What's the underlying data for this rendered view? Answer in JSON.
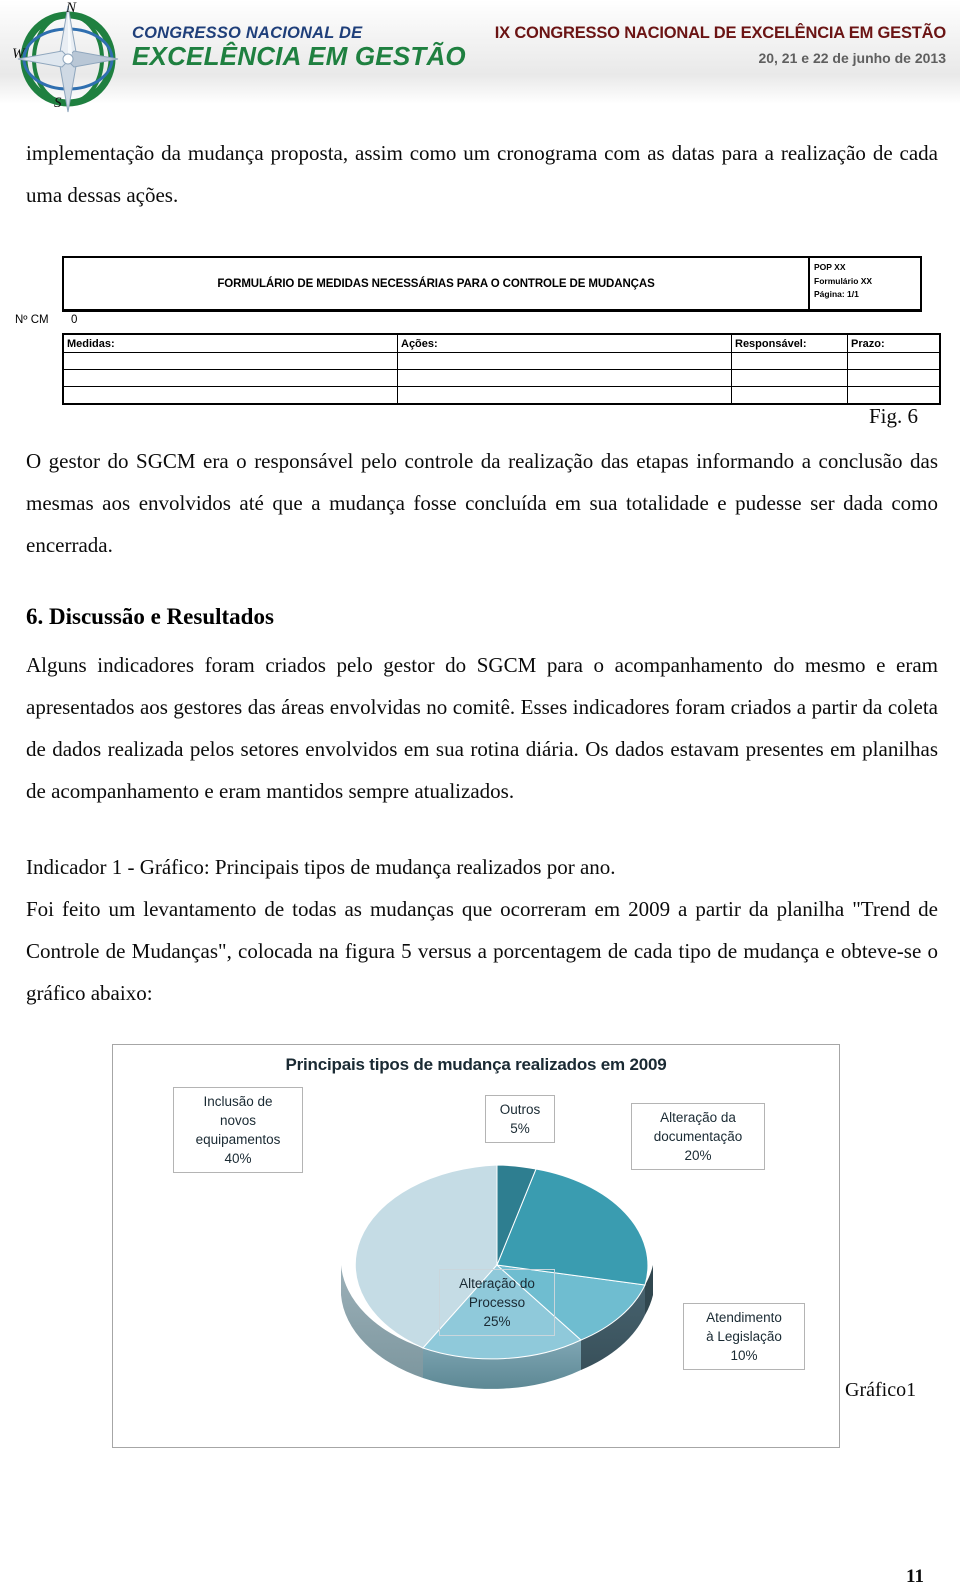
{
  "header": {
    "logo_line1": "CONGRESSO NACIONAL DE",
    "logo_line2": "EXCELÊNCIA EM GESTÃO",
    "compass_n": "N",
    "compass_s": "S",
    "compass_w": "W",
    "title": "IX CONGRESSO NACIONAL DE EXCELÊNCIA EM GESTÃO",
    "date": "20, 21 e  22 de junho de 2013",
    "title_color": "#6b1414",
    "date_color": "#5f5f5f",
    "logo_blue": "#1f3f7a",
    "logo_green": "#1f8040"
  },
  "body": {
    "paragraph_top": "implementação da mudança proposta, assim como um cronograma com as datas para a realização de cada uma dessas ações.",
    "fig_caption": "Fig. 6",
    "paragraph_gestor": "O gestor do SGCM era o responsável pelo controle da realização das etapas informando a conclusão das mesmas aos envolvidos até que a mudança fosse concluída em sua totalidade e pudesse ser dada como encerrada.",
    "section_heading": "6. Discussão e Resultados",
    "paragraph_discussao": "Alguns indicadores foram criados pelo gestor do SGCM para o acompanhamento do mesmo e eram apresentados aos gestores das áreas envolvidas no comitê. Esses indicadores foram criados a partir da coleta de dados realizada pelos setores envolvidos em sua rotina diária. Os dados estavam presentes em planilhas de acompanhamento e eram mantidos sempre atualizados.",
    "paragraph_indicador": "Indicador 1 -  Gráfico: Principais tipos de mudança realizados por ano.",
    "paragraph_foi": "Foi feito um levantamento de todas as mudanças que ocorreram em 2009 a partir da planilha \"Trend de Controle de Mudanças\", colocada na figura 5 versus a porcentagem de cada tipo de mudança e obteve-se o gráfico abaixo:",
    "chart_label": "Gráfico1",
    "page_number": "11"
  },
  "form": {
    "title": "FORMULÁRIO DE MEDIDAS NECESSÁRIAS PARA O CONTROLE DE MUDANÇAS",
    "meta": [
      "POP XX",
      "Formulário XX",
      "Página: 1/1"
    ],
    "ncm_label": "Nº CM",
    "ncm_value": "0",
    "columns": [
      "Medidas:",
      "Ações:",
      "Responsável:",
      "Prazo:"
    ],
    "rows": [
      [
        "",
        "",
        "",
        ""
      ],
      [
        "",
        "",
        "",
        ""
      ],
      [
        "",
        "",
        "",
        ""
      ]
    ]
  },
  "chart_data": {
    "type": "pie",
    "title": "Principais tipos de mudança realizados em 2009",
    "xlabel": "",
    "ylabel": "",
    "legend_position": "none",
    "grid": false,
    "three_d": true,
    "categories": [
      "Inclusão de novos equipamentos",
      "Outros",
      "Alteração da documentação",
      "Atendimento à Legislação",
      "Alteração do Processo"
    ],
    "values": [
      40,
      5,
      20,
      10,
      25
    ],
    "unit": "%",
    "colors": [
      "#c5dce5",
      "#2e7e90",
      "#3a9cb0",
      "#6fbdd0",
      "#8fc9da"
    ],
    "labels": [
      {
        "name": "Inclusão de novos equipamentos",
        "value": 40,
        "text": "Inclusão de\nnovos\nequipamentos\n40%"
      },
      {
        "name": "Outros",
        "value": 5,
        "text": "Outros\n5%"
      },
      {
        "name": "Alteração da documentação",
        "value": 20,
        "text": "Alteração da\ndocumentação\n20%"
      },
      {
        "name": "Alteração do Processo",
        "value": 25,
        "text": "Alteração do\nProcesso\n25%"
      },
      {
        "name": "Atendimento à Legislação",
        "value": 10,
        "text": "Atendimento\nà Legislação\n10%"
      }
    ],
    "callout_equipamentos_l1": "Inclusão de",
    "callout_equipamentos_l2": "novos",
    "callout_equipamentos_l3": "equipamentos",
    "callout_equipamentos_l4": "40%",
    "callout_outros_l1": "Outros",
    "callout_outros_l2": "5%",
    "callout_documentacao_l1": "Alteração da",
    "callout_documentacao_l2": "documentação",
    "callout_documentacao_l3": "20%",
    "callout_processo_l1": "Alteração do",
    "callout_processo_l2": "Processo",
    "callout_processo_l3": "25%",
    "callout_legislacao_l1": "Atendimento",
    "callout_legislacao_l2": "à Legislação",
    "callout_legislacao_l3": "10%"
  }
}
